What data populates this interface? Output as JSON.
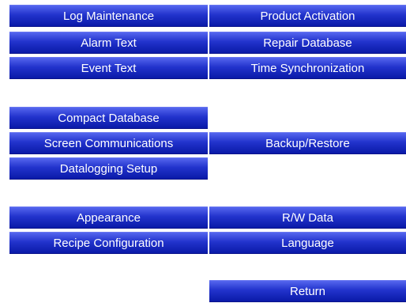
{
  "menu": {
    "group1": {
      "log_maintenance": "Log Maintenance",
      "product_activation": "Product Activation",
      "alarm_text": "Alarm Text",
      "repair_database": "Repair Database",
      "event_text": "Event Text",
      "time_synchronization": "Time Synchronization"
    },
    "group2": {
      "compact_database": "Compact Database",
      "screen_communications": "Screen Communications",
      "backup_restore": "Backup/Restore",
      "datalogging_setup": "Datalogging Setup"
    },
    "group3": {
      "appearance": "Appearance",
      "rw_data": "R/W Data",
      "recipe_configuration": "Recipe Configuration",
      "language": "Language"
    },
    "return_label": "Return"
  },
  "colors": {
    "button_top": "#5566ee",
    "button_mid": "#2233cc",
    "button_bottom": "#0a1aa8",
    "button_text": "#ffffff",
    "background": "#ffffff"
  }
}
